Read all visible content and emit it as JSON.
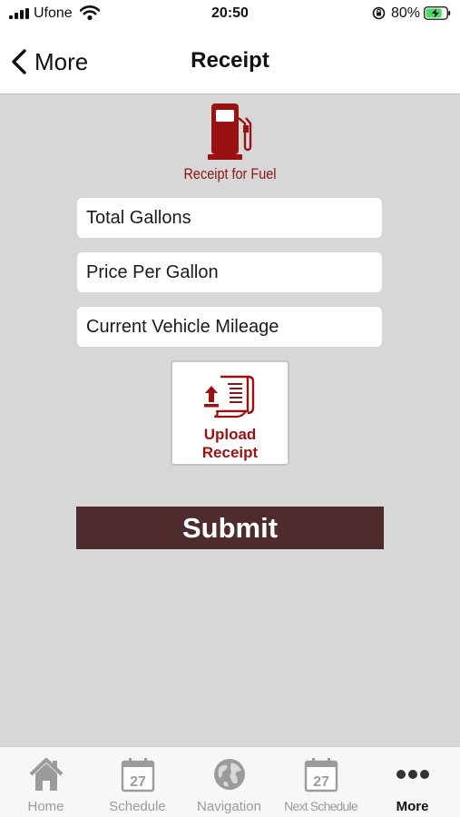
{
  "status_bar": {
    "carrier": "Ufone",
    "time": "20:50",
    "battery_percent": "80%",
    "battery_level": 0.8,
    "charging": true,
    "icons": [
      "signal-icon",
      "wifi-icon",
      "orientation-lock-icon",
      "battery-charging-icon"
    ]
  },
  "nav": {
    "back_label": "More",
    "title": "Receipt"
  },
  "header": {
    "icon": "fuel-pump-icon",
    "caption": "Receipt for Fuel"
  },
  "form": {
    "fields": [
      {
        "placeholder": "Total Gallons",
        "value": ""
      },
      {
        "placeholder": "Price Per Gallon",
        "value": ""
      },
      {
        "placeholder": "Current Vehicle Mileage",
        "value": ""
      }
    ],
    "upload": {
      "icon": "upload-document-icon",
      "line1": "Upload",
      "line2": "Receipt"
    },
    "submit_label": "Submit"
  },
  "tabs": [
    {
      "label": "Home",
      "icon": "home-icon",
      "active": false
    },
    {
      "label": "Schedule",
      "icon": "calendar-icon",
      "calendar_day": "27",
      "active": false
    },
    {
      "label": "Navigation",
      "icon": "globe-icon",
      "active": false
    },
    {
      "label": "Next Schedule",
      "icon": "calendar-icon",
      "calendar_day": "27",
      "active": false
    },
    {
      "label": "More",
      "icon": "more-dots-icon",
      "active": true
    }
  ],
  "colors": {
    "accent_red": "#8c1414",
    "submit_bg": "#4e2c2d",
    "background": "#d7d7d7",
    "tab_inactive": "#9b9b9b"
  }
}
